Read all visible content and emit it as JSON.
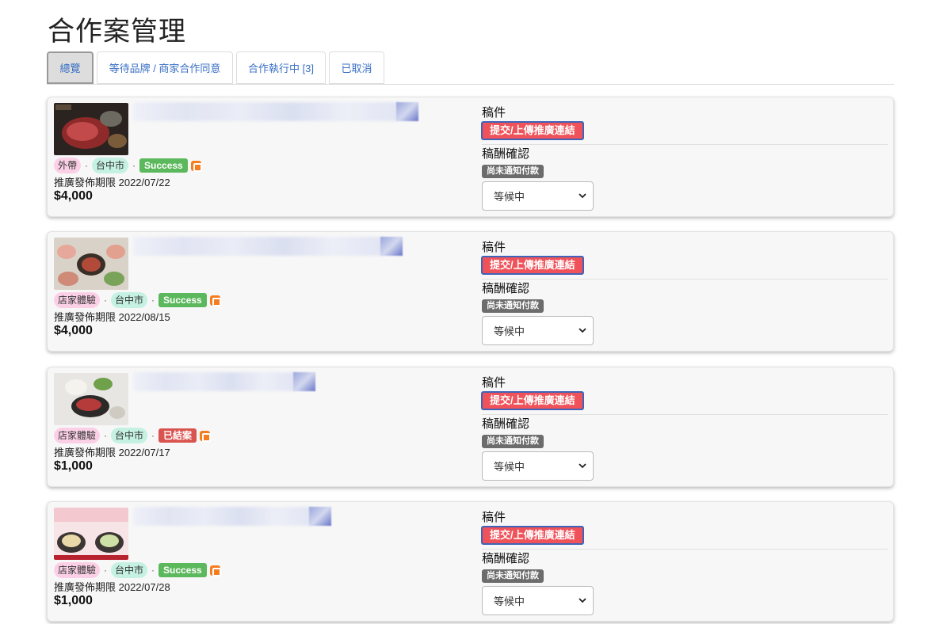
{
  "page": {
    "title": "合作案管理"
  },
  "tabs": [
    {
      "label": "總覽",
      "active": true
    },
    {
      "label": "等待品牌 / 商家合作同意",
      "active": false
    },
    {
      "label": "合作執行中 [3]",
      "active": false
    },
    {
      "label": "已取消",
      "active": false
    }
  ],
  "cards": [
    {
      "type_tag": "外帶",
      "city_tag": "台中市",
      "status": "Success",
      "status_color": "#5cb85c",
      "deadline": "推廣發佈期限 2022/07/22",
      "price": "$4,000",
      "submission_label": "稿件",
      "submit_button": "提交/上傳推廣連結",
      "payment_label": "稿酬確認",
      "payment_badge": "尚未通知付款",
      "select_value": "等候中"
    },
    {
      "type_tag": "店家體驗",
      "city_tag": "台中市",
      "status": "Success",
      "status_color": "#5cb85c",
      "deadline": "推廣發佈期限 2022/08/15",
      "price": "$4,000",
      "submission_label": "稿件",
      "submit_button": "提交/上傳推廣連結",
      "payment_label": "稿酬確認",
      "payment_badge": "尚未通知付款",
      "select_value": "等候中"
    },
    {
      "type_tag": "店家體驗",
      "city_tag": "台中市",
      "status": "已結案",
      "status_color": "#d9534f",
      "deadline": "推廣發佈期限 2022/07/17",
      "price": "$1,000",
      "submission_label": "稿件",
      "submit_button": "提交/上傳推廣連結",
      "payment_label": "稿酬確認",
      "payment_badge": "尚未通知付款",
      "select_value": "等候中"
    },
    {
      "type_tag": "店家體驗",
      "city_tag": "台中市",
      "status": "Success",
      "status_color": "#5cb85c",
      "deadline": "推廣發佈期限 2022/07/28",
      "price": "$1,000",
      "submission_label": "稿件",
      "submit_button": "提交/上傳推廣連結",
      "payment_label": "稿酬確認",
      "payment_badge": "尚未通知付款",
      "select_value": "等候中"
    }
  ],
  "icons": {
    "blog": "blogger-icon",
    "select": "chevron-down-icon"
  },
  "colors": {
    "submit_button": "#f0525a",
    "submit_border": "#3e63b8",
    "pink_tag": "#fbd0e6",
    "teal_tag": "#c5f1e2",
    "blog_icon": "#f57c1f",
    "tab_text": "#3a70c4"
  }
}
